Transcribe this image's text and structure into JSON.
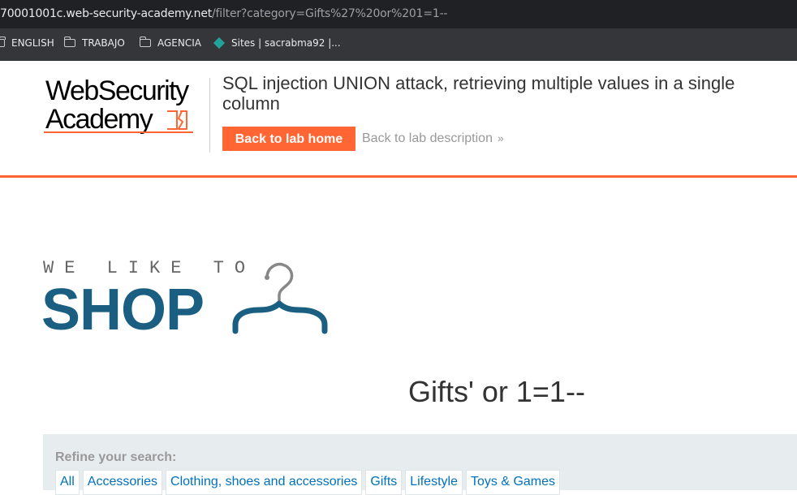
{
  "browser": {
    "url_host": "70001001c.web-security-academy.net",
    "url_path": "/filter?category=Gifts%27%20or%201=1--",
    "bookmarks": [
      {
        "label": "ENGLISH",
        "icon": "folder-icon"
      },
      {
        "label": "TRABAJO",
        "icon": "folder-icon"
      },
      {
        "label": "AGENCIA",
        "icon": "folder-icon"
      },
      {
        "label": "Sites | sacrabma92 |...",
        "icon": "sites-diamond-icon"
      }
    ]
  },
  "academy": {
    "logo_line1": "WebSecurity",
    "logo_line2": "Academy",
    "lab_title": "SQL injection UNION attack, retrieving multiple values in a single column",
    "back_home_label": "Back to lab home",
    "back_description_label": "Back to lab description",
    "accent_color": "#ff6633"
  },
  "shop": {
    "tagline": "WE LIKE TO",
    "brand": "SHOP",
    "brand_color": "#1a5f82"
  },
  "main": {
    "heading": "Gifts' or 1=1--"
  },
  "filter": {
    "label": "Refine your search:",
    "categories": [
      "All",
      "Accessories",
      "Clothing, shoes and accessories",
      "Gifts",
      "Lifestyle",
      "Toys & Games"
    ]
  }
}
